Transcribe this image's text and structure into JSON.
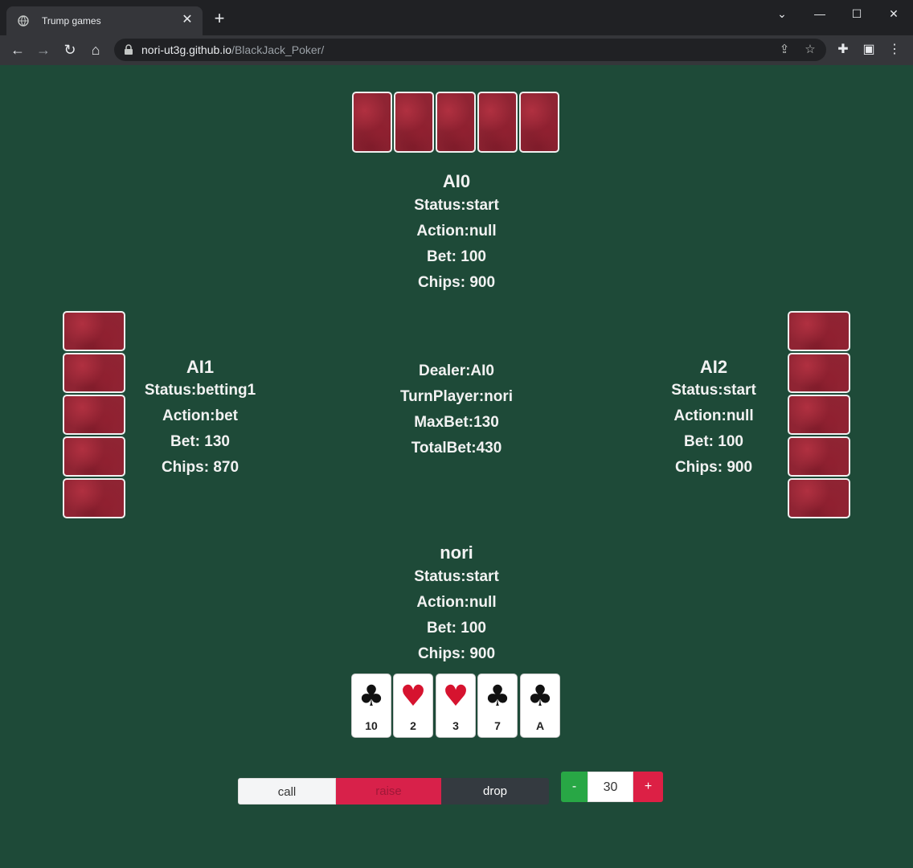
{
  "browser": {
    "tab_title": "Trump games",
    "url_host": "nori-ut3g.github.io",
    "url_path": "/BlackJack_Poker/"
  },
  "players": {
    "top": {
      "name": "AI0",
      "status": "Status:start",
      "action": "Action:null",
      "bet": "Bet: 100",
      "chips": "Chips: 900",
      "cards_face_down": 5
    },
    "left": {
      "name": "AI1",
      "status": "Status:betting1",
      "action": "Action:bet",
      "bet": "Bet: 130",
      "chips": "Chips: 870",
      "cards_face_down": 5
    },
    "right": {
      "name": "AI2",
      "status": "Status:start",
      "action": "Action:null",
      "bet": "Bet: 100",
      "chips": "Chips: 900",
      "cards_face_down": 5
    },
    "bottom": {
      "name": "nori",
      "status": "Status:start",
      "action": "Action:null",
      "bet": "Bet: 100",
      "chips": "Chips: 900"
    }
  },
  "table": {
    "dealer": "Dealer:AI0",
    "turn_player": "TurnPlayer:nori",
    "max_bet": "MaxBet:130",
    "total_bet": "TotalBet:430"
  },
  "hand": [
    {
      "suit": "♣",
      "color": "black",
      "rank": "10"
    },
    {
      "suit": "♥",
      "color": "red",
      "rank": "2"
    },
    {
      "suit": "♥",
      "color": "red",
      "rank": "3"
    },
    {
      "suit": "♣",
      "color": "black",
      "rank": "7"
    },
    {
      "suit": "♣",
      "color": "black",
      "rank": "A"
    }
  ],
  "controls": {
    "call_label": "call",
    "raise_label": "raise",
    "drop_label": "drop",
    "minus_label": "-",
    "amount": "30",
    "plus_label": "+"
  },
  "colors": {
    "table_green": "#1e4a38",
    "card_back": "#8f2433",
    "raise": "#d8214a",
    "drop": "#343a40",
    "minus": "#28a745",
    "plus": "#dc2045"
  }
}
